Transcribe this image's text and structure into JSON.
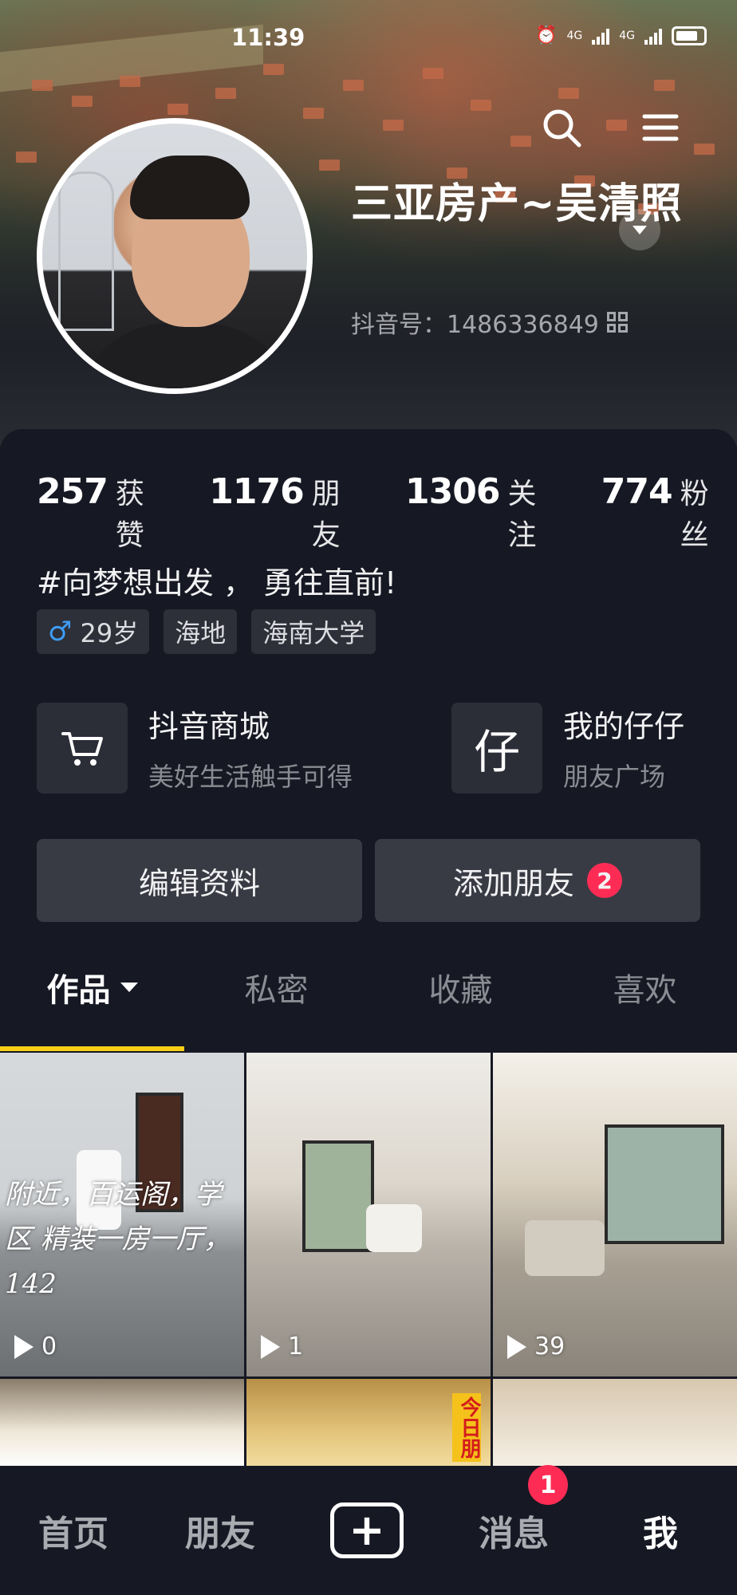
{
  "status_bar": {
    "time": "11:39",
    "network_1": "4G",
    "network_2": "4G"
  },
  "profile": {
    "nickname": "三亚房产~吴清照",
    "douyin_id": "抖音号：1486336849",
    "bio": "#向梦想出发 ， 勇往直前!",
    "tags": [
      {
        "label": "29岁",
        "icon": "male-icon"
      },
      {
        "label": "海地"
      },
      {
        "label": "海南大学"
      }
    ]
  },
  "stats": [
    {
      "value": "257",
      "label": "获赞"
    },
    {
      "value": "1176",
      "label": "朋友"
    },
    {
      "value": "1306",
      "label": "关注"
    },
    {
      "value": "774",
      "label": "粉丝"
    }
  ],
  "features": {
    "shop": {
      "title": "抖音商城",
      "subtitle": "美好生活触手可得",
      "icon": "shopping-cart-icon"
    },
    "zaizai": {
      "title": "我的仔仔",
      "subtitle": "朋友广场",
      "icon": "zai-icon",
      "glyph": "仔"
    }
  },
  "actions": {
    "edit_label": "编辑资料",
    "add_friend_label": "添加朋友",
    "add_friend_badge": "2"
  },
  "tabs": [
    {
      "label": "作品",
      "active": true
    },
    {
      "label": "私密"
    },
    {
      "label": "收藏"
    },
    {
      "label": "喜欢"
    }
  ],
  "videos": [
    {
      "plays": "0",
      "overlay": "附近，百运阁，学区 精装一房一厅，142"
    },
    {
      "plays": "1"
    },
    {
      "plays": "39"
    },
    {
      "plays": ""
    },
    {
      "plays": "",
      "overlay_vertical": "今日朋"
    },
    {
      "plays": ""
    }
  ],
  "bottom_nav": {
    "home": "首页",
    "friends": "朋友",
    "create": "+",
    "messages": "消息",
    "messages_badge": "1",
    "me": "我"
  },
  "colors": {
    "accent_yellow": "#face15",
    "badge_red": "#fe2c55",
    "background": "#161823"
  }
}
